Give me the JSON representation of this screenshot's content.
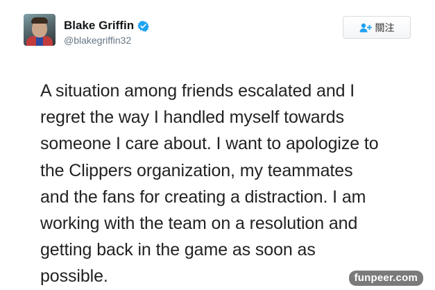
{
  "user": {
    "display_name": "Blake Griffin",
    "handle": "@blakegriffin32",
    "verified": true,
    "avatar_icon": "profile-photo"
  },
  "follow_button": {
    "label": "關注",
    "icon": "add-user-icon",
    "accent_color": "#1da1f2"
  },
  "tweet": {
    "lines": [
      "A situation among friends escalated and I",
      "regret the way I handled myself towards",
      "someone I care about. I want to apologize to",
      "the Clippers organization, my teammates",
      "and the fans for creating a distraction. I am",
      "working with the team on a resolution and",
      "getting back in the game as soon as",
      "possible."
    ]
  },
  "watermark": {
    "text": "funpeer.com"
  },
  "colors": {
    "verified_badge": "#1da1f2",
    "handle_text": "#657786",
    "body_text": "#222222",
    "watermark_bg": "#7a7a7a"
  }
}
